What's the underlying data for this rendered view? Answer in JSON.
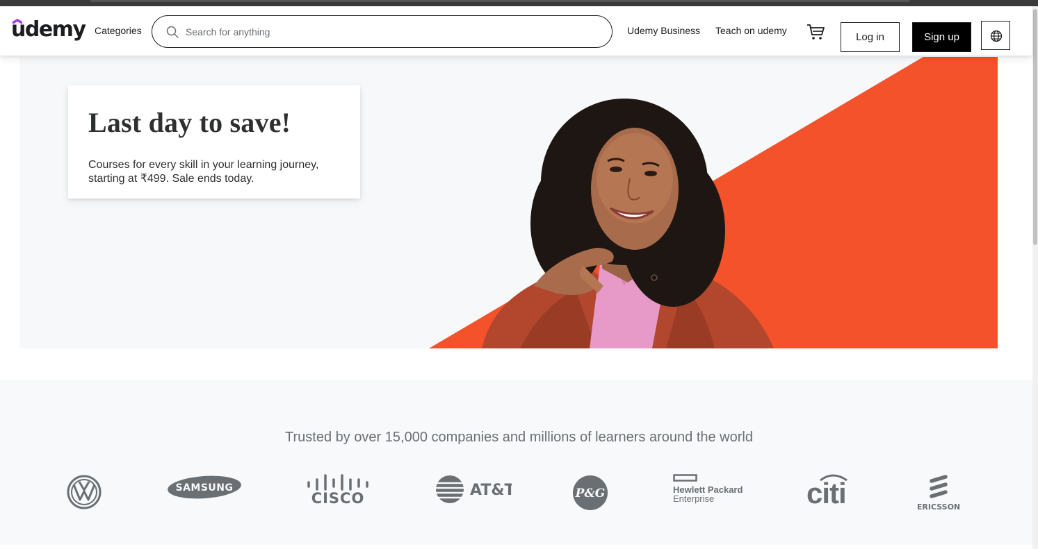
{
  "brand": {
    "name": "udemy",
    "accent": "#a435f0"
  },
  "header": {
    "categories_label": "Categories",
    "search_placeholder": "Search for anything",
    "business_link": "Udemy Business",
    "teach_link": "Teach on udemy",
    "login_label": "Log in",
    "signup_label": "Sign up",
    "icons": [
      "search-icon",
      "cart-icon",
      "globe-icon"
    ]
  },
  "hero": {
    "title": "Last day to save!",
    "subtitle": "Courses for every skill in your learning journey, starting at ₹499. Sale ends today.",
    "accent_color": "#f4522b"
  },
  "trusted": {
    "tagline": "Trusted by over 15,000 companies and millions of learners around the world",
    "logos": [
      {
        "name": "volkswagen",
        "text": ""
      },
      {
        "name": "samsung",
        "text": "SAMSUNG"
      },
      {
        "name": "cisco",
        "text": "CISCO"
      },
      {
        "name": "att",
        "text": "AT&T"
      },
      {
        "name": "procter-gamble",
        "text": "P&G"
      },
      {
        "name": "hewlett-packard-enterprise",
        "text": "Hewlett Packard",
        "text2": "Enterprise"
      },
      {
        "name": "citi",
        "text": "citi"
      },
      {
        "name": "ericsson",
        "text": "ERICSSON"
      }
    ]
  }
}
